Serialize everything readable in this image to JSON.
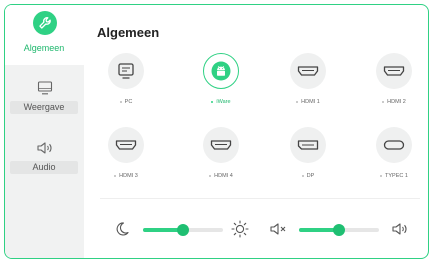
{
  "sidebar": {
    "items": [
      {
        "label": "Algemeen",
        "icon": "wrench-icon",
        "active": true
      },
      {
        "label": "Weergave",
        "icon": "monitor-icon",
        "active": false
      },
      {
        "label": "Audio",
        "icon": "speaker-icon",
        "active": false
      }
    ]
  },
  "main": {
    "title": "Algemeen",
    "sources": [
      {
        "label": "PC",
        "icon": "pc-icon",
        "active": false
      },
      {
        "label": "iWare",
        "icon": "android-icon",
        "active": true
      },
      {
        "label": "HDMI 1",
        "icon": "hdmi-port-icon",
        "active": false
      },
      {
        "label": "HDMI 2",
        "icon": "hdmi-port-icon",
        "active": false
      },
      {
        "label": "HDMI 3",
        "icon": "hdmi-port-icon",
        "active": false
      },
      {
        "label": "HDMI 4",
        "icon": "hdmi-port-icon",
        "active": false
      },
      {
        "label": "DP",
        "icon": "displayport-icon",
        "active": false
      },
      {
        "label": "TYPEC 1",
        "icon": "usb-c-icon",
        "active": false
      }
    ],
    "brightness": {
      "value": 0.5,
      "low_icon": "moon-icon",
      "high_icon": "sun-icon"
    },
    "volume": {
      "value": 0.5,
      "low_icon": "mute-icon",
      "high_icon": "speaker-icon"
    }
  },
  "colors": {
    "accent": "#2fd184",
    "accent_dark": "#1fbf72",
    "sidebar_bg": "#f1f2f2"
  }
}
